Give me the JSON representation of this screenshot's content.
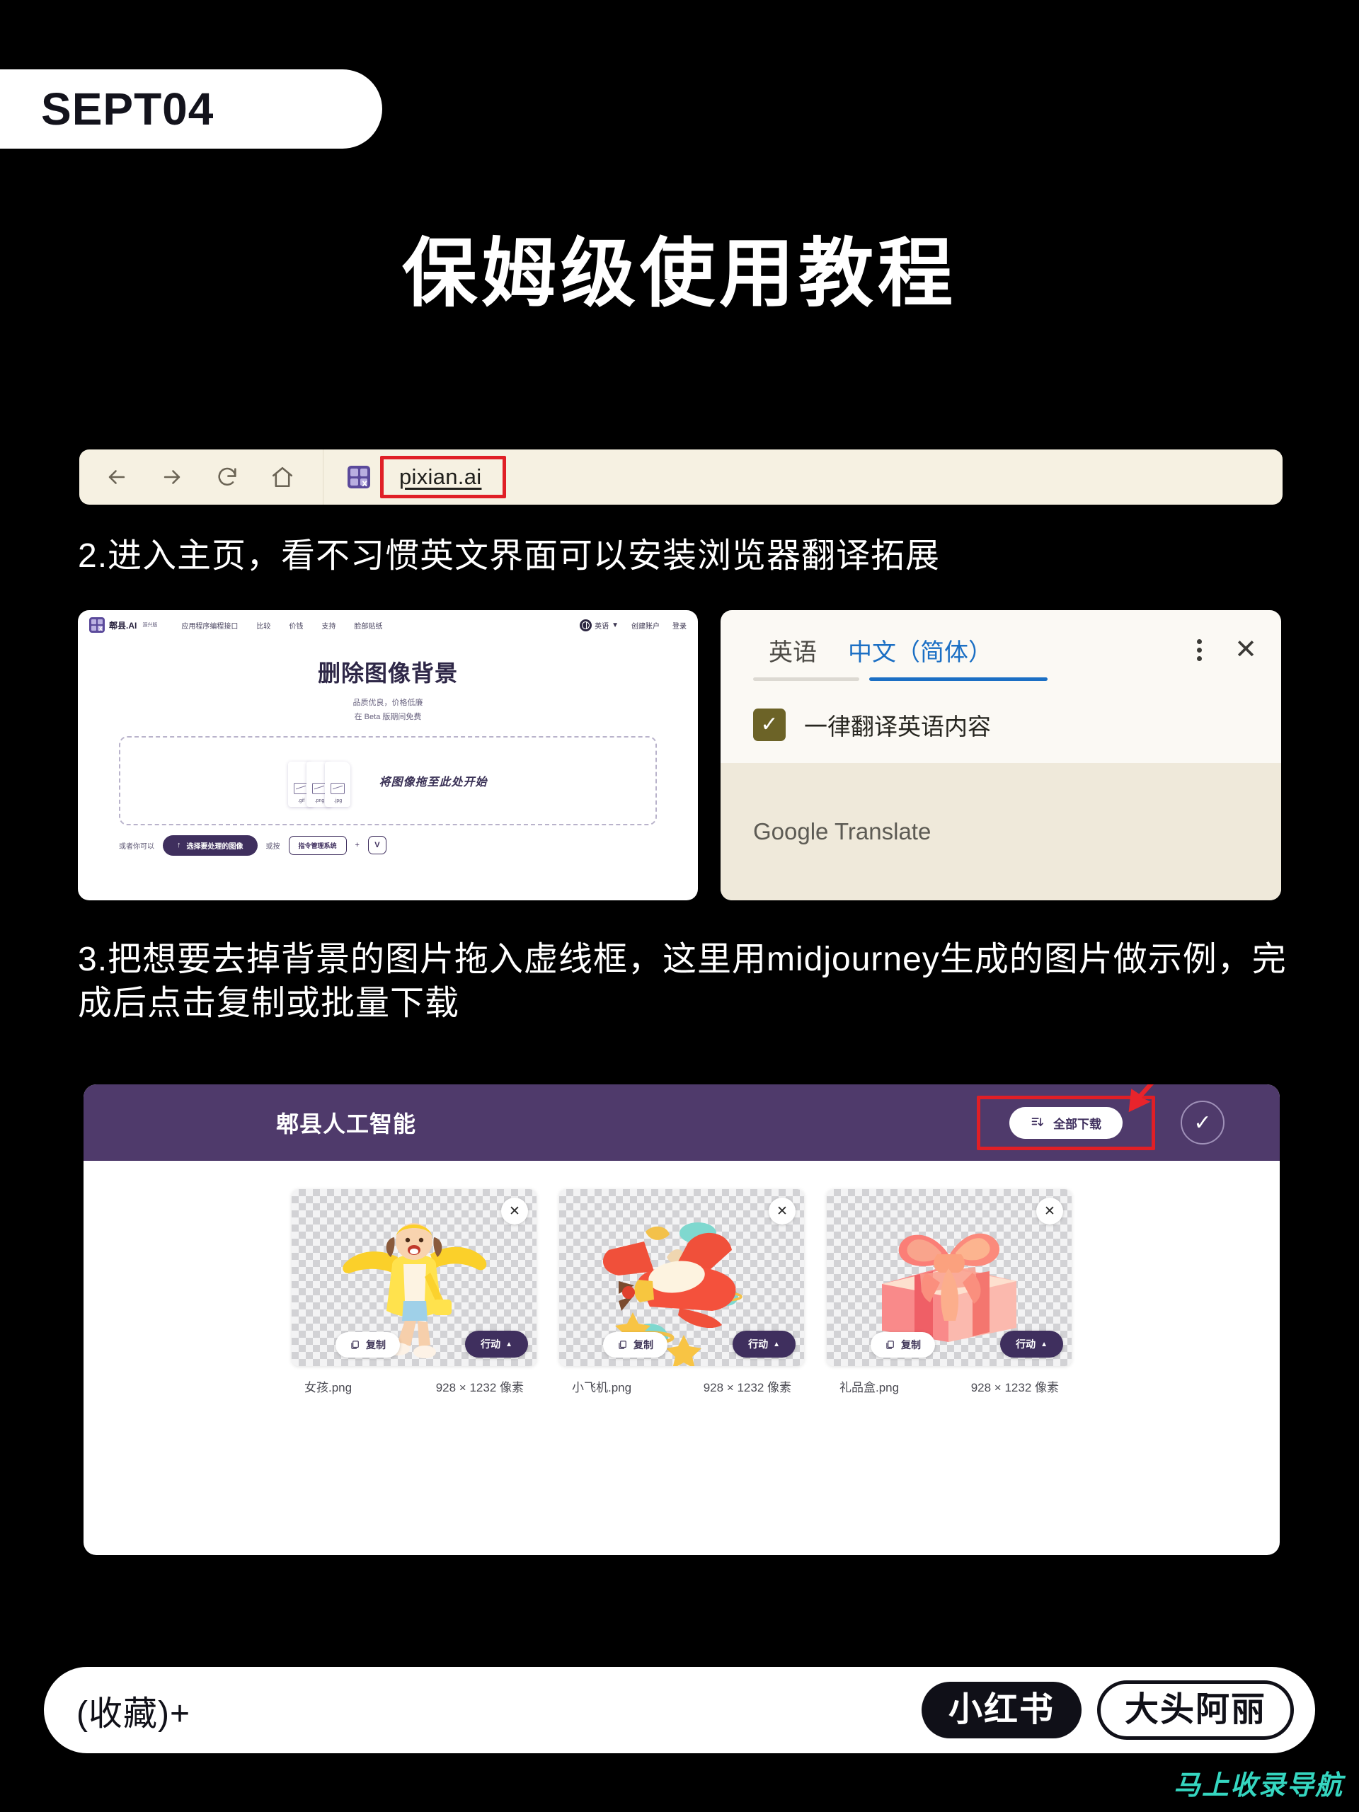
{
  "badge": {
    "label": "SEPT04"
  },
  "title": "保姆级使用教程",
  "browser": {
    "icons": {
      "back": "back-arrow-icon",
      "forward": "forward-arrow-icon",
      "reload": "reload-icon",
      "home": "home-icon"
    },
    "favicon_letter": "x",
    "url": "pixian.ai",
    "highlight_color": "#e01f26"
  },
  "steps": {
    "step2": "2.进入主页，看不习惯英文界面可以安装浏览器翻译拓展",
    "step3": "3.把想要去掉背景的图片拖入虚线框，这里用midjourney生成的图片做示例，完成后点击复制或批量下载"
  },
  "site": {
    "logo_text": "郫县.AI",
    "logo_sup": "源兴版",
    "menu": [
      "应用程序编程接口",
      "比较",
      "价钱",
      "支持",
      "脸部贴纸"
    ],
    "language": "英语",
    "create_account": "创建账户",
    "login": "登录",
    "heading": "删除图像背景",
    "sub1": "品质优良，价格低廉",
    "sub2": "在 Beta 版期间免费",
    "dropzone_text": "将图像拖至此处开始",
    "file_exts": [
      ".gif",
      ".png",
      ".jpg"
    ],
    "or_label": "或者你可以",
    "pick_button": "选择要处理的图像",
    "or_press": "或按",
    "key_button": "指令管理系统",
    "plus": "+",
    "key_v": "V"
  },
  "translate": {
    "tab_source": "英语",
    "tab_target": "中文（简体）",
    "active_tab": "中文（简体）",
    "checkbox_label": "一律翻译英语内容",
    "checkbox_checked": "✓",
    "brand": "Google Translate",
    "accent_color": "#1b6fc4",
    "checkbox_color": "#6c6327"
  },
  "panel": {
    "title": "郫县人工智能",
    "download_all": "全部下载",
    "check_mark": "✓",
    "header_color": "#4f3a6b",
    "cards": [
      {
        "name": "女孩.png",
        "size": "928 × 1232 像素",
        "copy": "复制",
        "action": "行动",
        "close": "✕",
        "art": "girl-yellow-jacket"
      },
      {
        "name": "小飞机.png",
        "size": "928 × 1232 像素",
        "copy": "复制",
        "action": "行动",
        "close": "✕",
        "art": "red-toy-airplane"
      },
      {
        "name": "礼品盒.png",
        "size": "928 × 1232 像素",
        "copy": "复制",
        "action": "行动",
        "close": "✕",
        "art": "pink-gift-box"
      }
    ]
  },
  "footer": {
    "favorite": "(收藏)+",
    "platform": "小红书",
    "author": "大头阿丽",
    "watermark": "马上收录导航"
  }
}
